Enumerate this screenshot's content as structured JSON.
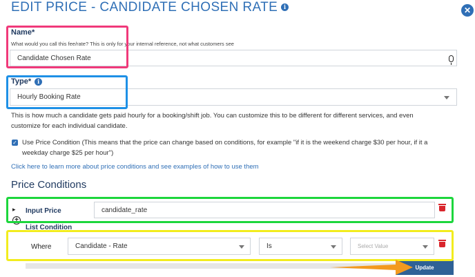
{
  "header": {
    "title": "EDIT PRICE - CANDIDATE CHOSEN RATE",
    "info_glyph": "i",
    "close_glyph": "✕"
  },
  "name_field": {
    "label": "Name*",
    "help": "What would you call this fee/rate? This is only for your internal reference, not what customers see",
    "value": "Candidate Chosen Rate"
  },
  "type_field": {
    "label": "Type*",
    "info_glyph": "i",
    "value": "Hourly Booking Rate",
    "description_1": "This is how much a candidate gets paid hourly for a booking/shift job. You can customize this to be different for different services, and even",
    "description_2": "customize for each individual candidate."
  },
  "price_condition": {
    "check_glyph": "✓",
    "label_1": "Use Price Condition (This means that the price can change based on conditions, for example \"if it is the weekend charge $30 per hour, if it a",
    "label_2": "weekday charge $25 per hour\")",
    "link": "Click here to learn more about price conditions and see examples of how to use them"
  },
  "conditions": {
    "heading": "Price Conditions",
    "input_price_label": "Input Price",
    "input_price_value": "candidate_rate",
    "list_condition_label": "List Condition",
    "where_label": "Where",
    "field_select": "Candidate - Rate",
    "operator_select": "Is",
    "value_placeholder": "Select Value",
    "expand_glyph": "▸",
    "add_glyph": "+"
  },
  "footer": {
    "update_label": "Update"
  },
  "colors": {
    "accent": "#2f6fb6",
    "annot_pink": "#f0397a",
    "annot_blue": "#1e90e6",
    "annot_green": "#1cd63c",
    "annot_yellow": "#f2ec1e",
    "annot_arrow": "#f39a1f"
  }
}
